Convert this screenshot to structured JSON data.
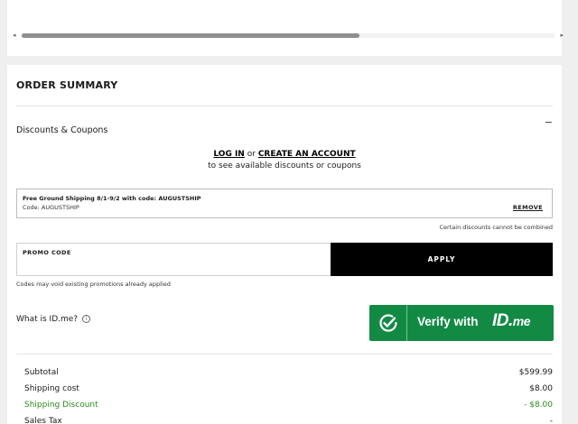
{
  "scrollbar": {
    "left_arrow": "◂",
    "right_arrow": "▸"
  },
  "summary": {
    "title": "ORDER SUMMARY",
    "discounts_label": "Discounts & Coupons",
    "collapse_glyph": "−",
    "login_link": "LOG IN",
    "or_text": "or",
    "create_account_link": "CREATE AN ACCOUNT",
    "login_sub": "to see available discounts or coupons"
  },
  "coupon": {
    "description": "Free Ground Shipping 8/1-9/2 with code: AUGUSTSHIP",
    "code_line": "Code: AUGUSTSHIP",
    "remove_label": "REMOVE"
  },
  "combine_note": "Certain discounts cannot be combined",
  "promo": {
    "label": "PROMO CODE",
    "value": "",
    "apply_label": "APPLY",
    "note": "Codes may void existing promotions already applied"
  },
  "idme": {
    "question": "What is ID.me?",
    "info_glyph": "i",
    "verify_text": "Verify with",
    "brand_id": "ID.",
    "brand_me": "me",
    "button_color": "#128a44"
  },
  "totals": [
    {
      "label": "Subtotal",
      "value": "$599.99",
      "color": "#1a1a1a"
    },
    {
      "label": "Shipping cost",
      "value": "$8.00",
      "color": "#1a1a1a"
    },
    {
      "label": "Shipping Discount",
      "value": "- $8.00",
      "color": "#2e8b1e"
    },
    {
      "label": "Sales Tax",
      "value": "-",
      "color": "#1a1a1a"
    }
  ]
}
